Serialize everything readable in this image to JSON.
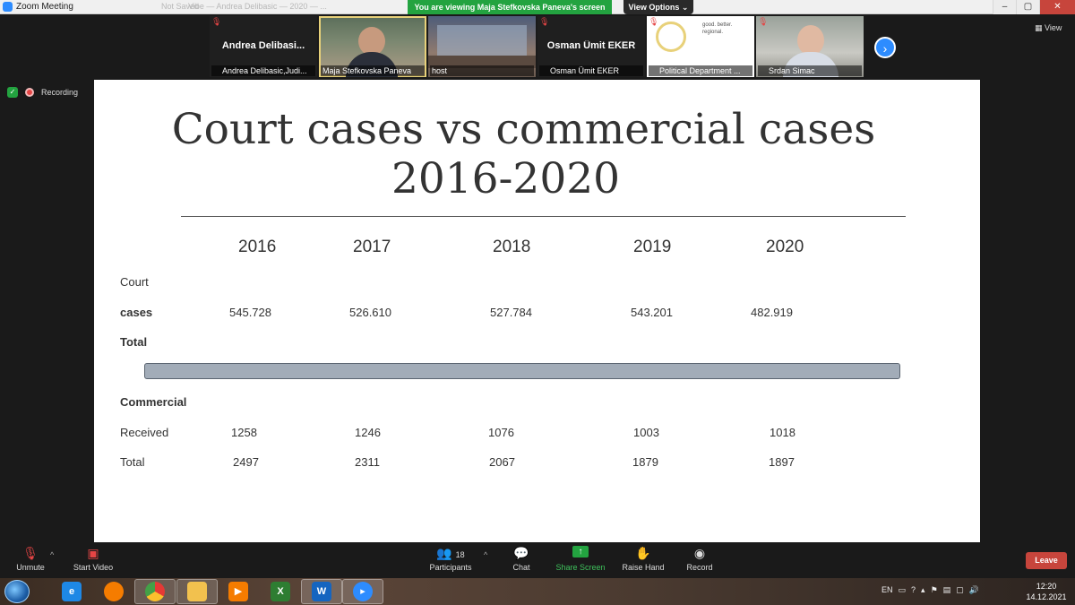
{
  "window": {
    "title": "Zoom Meeting",
    "title_extra_left": "Not Saved",
    "title_extra_mid": "Vibe — Andrea Delibasic — 2020 — ...",
    "banner": "You are viewing Maja Stefkovska Paneva's screen",
    "view_options": "View Options",
    "view_button": "View",
    "controls": {
      "minimize": "–",
      "maximize": "▢",
      "close": "✕"
    }
  },
  "thumbnails": [
    {
      "center_name": "Andrea  Delibasi...",
      "label": "Andrea Delibasic,Judi...",
      "muted": true
    },
    {
      "center_name": "",
      "label": "Maja Stefkovska Paneva",
      "muted": false,
      "active": true
    },
    {
      "center_name": "",
      "label": "host",
      "muted": false
    },
    {
      "center_name": "Osman Ümit EKER",
      "label": "Osman Ümit EKER",
      "muted": true
    },
    {
      "center_name": "",
      "label": "Political Department ...",
      "muted": true,
      "logo_text": "good. better. regional."
    },
    {
      "center_name": "",
      "label": "Srdan Simac",
      "muted": true
    }
  ],
  "status": {
    "recording": "Recording"
  },
  "slide": {
    "title_line1": "Court cases vs commercial cases",
    "title_line2": "2016-2020",
    "years": [
      "2016",
      "2017",
      "2018",
      "2019",
      "2020"
    ],
    "court_label_1": "Court",
    "court_label_2": "cases",
    "court_label_3": "Total",
    "court_values": [
      "545.728",
      "526.610",
      "527.784",
      "543.201",
      "482.919"
    ],
    "commercial_label": "Commercial",
    "received_label": "Received",
    "received_values": [
      "1258",
      "1246",
      "1076",
      "1003",
      "1018"
    ],
    "total_label": "Total",
    "total_values": [
      "2497",
      "2311",
      "2067",
      "1879",
      "1897"
    ]
  },
  "toolbar": {
    "unmute": "Unmute",
    "start_video": "Start Video",
    "participants": "Participants",
    "participants_count": "18",
    "chat": "Chat",
    "share_screen": "Share Screen",
    "raise_hand": "Raise Hand",
    "record": "Record",
    "leave": "Leave"
  },
  "taskbar": {
    "lang": "EN",
    "time": "12:20",
    "date": "14.12.2021",
    "apps": [
      "internet-explorer",
      "firefox",
      "chrome",
      "file-explorer",
      "media-player",
      "excel",
      "word",
      "zoom"
    ]
  }
}
